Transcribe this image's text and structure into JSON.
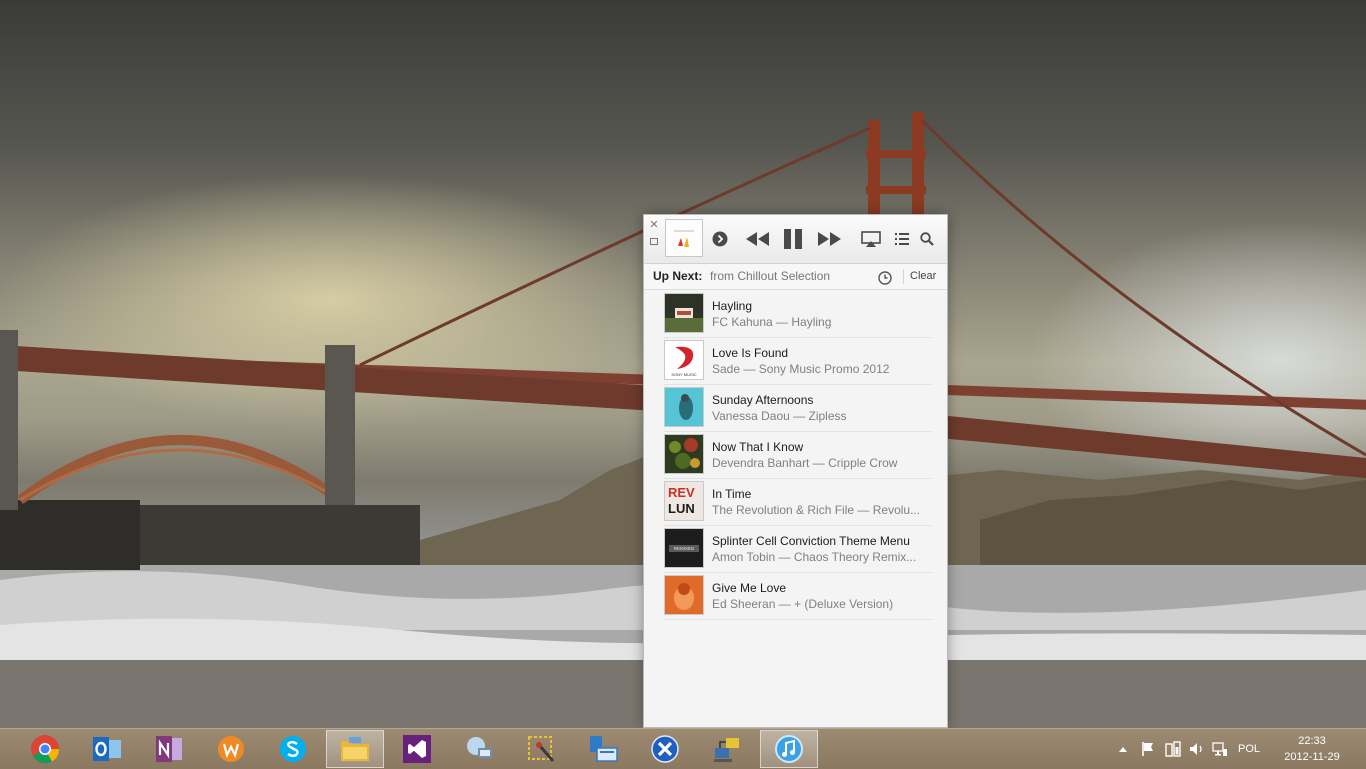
{
  "player": {
    "upnext": {
      "title": "Up Next:",
      "source": "from Chillout Selection",
      "clear_label": "Clear"
    },
    "tracks": [
      {
        "title": "Hayling",
        "subtitle": "FC Kahuna — Hayling"
      },
      {
        "title": "Love Is Found",
        "subtitle": "Sade — Sony Music Promo 2012"
      },
      {
        "title": "Sunday Afternoons",
        "subtitle": "Vanessa Daou — Zipless"
      },
      {
        "title": "Now That I Know",
        "subtitle": "Devendra Banhart — Cripple Crow"
      },
      {
        "title": "In Time",
        "subtitle": "The Revolution & Rich File — Revolu..."
      },
      {
        "title": "Splinter Cell Conviction Theme Menu",
        "subtitle": "Amon Tobin — Chaos Theory Remix..."
      },
      {
        "title": "Give Me Love",
        "subtitle": "Ed Sheeran — + (Deluxe Version)"
      }
    ],
    "artwork_text": {
      "sony": "SONY MUSIC",
      "intime_1": "REV",
      "intime_2": "LUN",
      "amon": "REMIXED"
    }
  },
  "taskbar": {
    "apps": [
      "chrome-icon",
      "outlook-icon",
      "onenote-icon",
      "wps-icon",
      "skype-icon",
      "file-explorer-icon",
      "visual-studio-icon",
      "network-tool-icon",
      "snipping-tool-icon",
      "remote-desktop-icon",
      "xamarin-icon",
      "network-connect-icon",
      "itunes-icon"
    ],
    "tray": {
      "language": "POL",
      "time": "22:33",
      "date": "2012-11-29"
    }
  }
}
